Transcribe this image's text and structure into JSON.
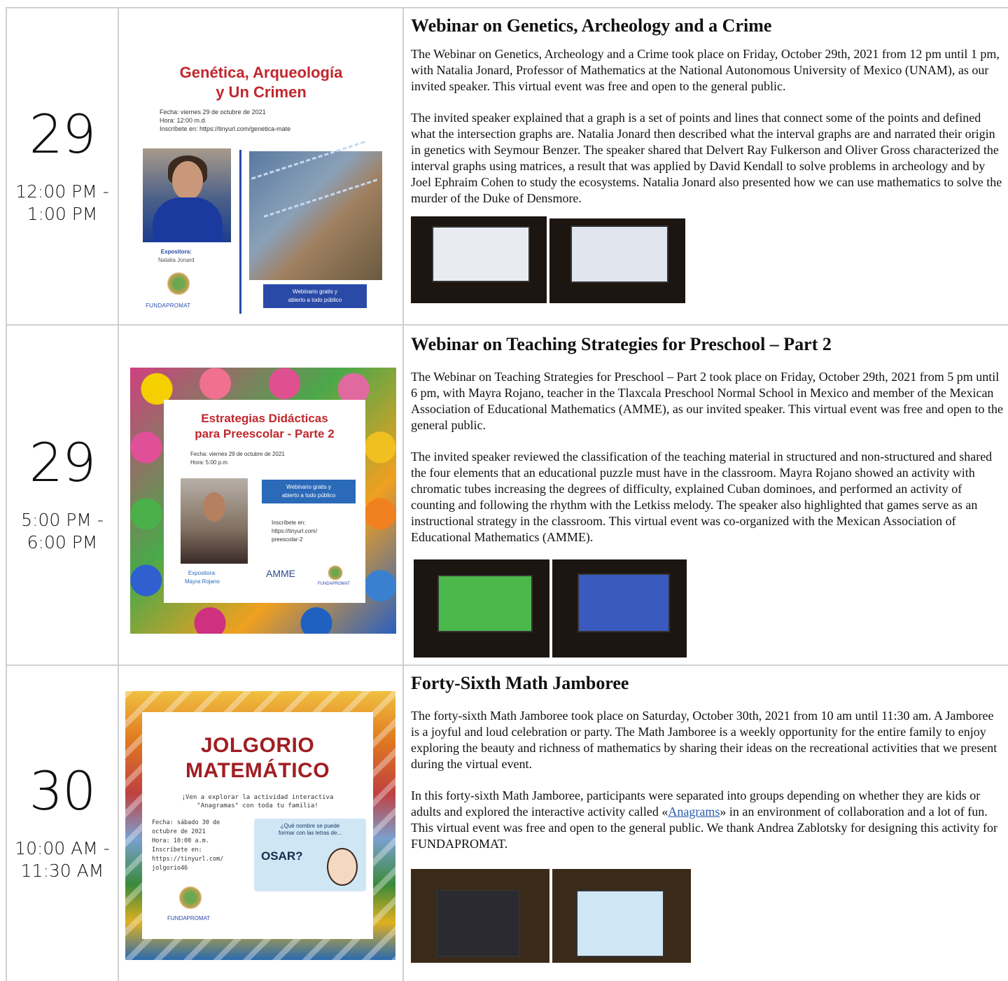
{
  "events": [
    {
      "day": "29",
      "time_line1": "12:00 PM -",
      "time_line2": "1:00 PM",
      "title": "Webinar on Genetics, Archeology and a Crime",
      "paragraphs": [
        "The Webinar on Genetics, Archeology and a Crime took place on Friday, October 29th, 2021 from 12 pm until 1 pm, with Natalia Jonard, Professor of Mathematics at the National Autonomous University of Mexico (UNAM), as our invited speaker. This virtual event was free and open to the general public.",
        "The invited speaker explained that a graph is a set of points and lines that connect some of the points and defined what the intersection graphs are. Natalia Jonard then described what the interval graphs are and narrated their origin in genetics with Seymour Benzer. The speaker shared that Delvert Ray Fulkerson and Oliver Gross characterized the interval graphs using matrices, a result that was applied by David Kendall to solve problems in archeology and by Joel Ephraim Cohen to study the ecosystems. Natalia Jonard also presented how we can use mathematics to solve the murder of the Duke of Densmore."
      ],
      "poster": {
        "title_line1": "Genética, Arqueología",
        "title_line2": "y Un Crimen",
        "fecha": "Fecha: viernes 29 de octubre de 2021",
        "hora": "Hora: 12:00 m.d.",
        "inscribete": "Inscríbete en: https://tinyurl.com/genetica-mate",
        "expositora_label": "Expositora:",
        "expositora_name": "Natalia Jonard",
        "logo": "FUNDAPROMAT",
        "button_line1": "Webinario gratis y",
        "button_line2": "abierto a todo público"
      }
    },
    {
      "day": "29",
      "time_line1": "5:00 PM -",
      "time_line2": "6:00 PM",
      "title": "Webinar on Teaching Strategies for Preschool – Part 2",
      "paragraphs": [
        "The Webinar on Teaching Strategies for Preschool – Part 2 took place on Friday, October 29th, 2021 from 5 pm until 6 pm, with Mayra Rojano, teacher in the Tlaxcala Preschool Normal School in Mexico and member of the Mexican Association of Educational Mathematics (AMME), as our invited speaker. This virtual event was free and open to the general public.",
        "The invited speaker reviewed the classification of the teaching material in structured and non-structured and shared the four elements that an educational puzzle must have in the classroom. Mayra Rojano showed an activity with chromatic tubes increasing the degrees of difficulty, explained Cuban dominoes, and performed an activity of counting and following the rhythm with the Letkiss melody. The speaker also highlighted that games serve as an instructional strategy in the classroom. This virtual event was co-organized with the Mexican Association of Educational Mathematics (AMME)."
      ],
      "poster": {
        "title_line1": "Estrategias Didácticas",
        "title_line2": "para Preescolar - Parte 2",
        "fecha": "Fecha: viernes 29 de octubre de 2021",
        "hora": "Hora: 5:00 p.m.",
        "button_line1": "Webinario gratis y",
        "button_line2": "abierto a todo público",
        "inscribete_label": "Inscríbete en:",
        "inscribete_url1": "https://tinyurl.com/",
        "inscribete_url2": "preescolar-2",
        "expositora_label": "Expositora:",
        "expositora_name": "Mayra Rojano",
        "amme": "AMME",
        "logo": "FUNDAPROMAT"
      }
    },
    {
      "day": "30",
      "time_line1": "10:00 AM -",
      "time_line2": "11:30 AM",
      "title": "Forty-Sixth Math Jamboree",
      "paragraphs": [
        "The forty-sixth Math Jamboree took place on Saturday, October 30th, 2021 from 10 am until 11:30 am. A Jamboree is a joyful and loud celebration or party. The Math Jamboree is a weekly opportunity for the entire family to enjoy exploring the beauty and richness of mathematics by sharing their ideas on the recreational activities that we present during the virtual event."
      ],
      "para2_before": "In this forty-sixth Math Jamboree, participants were separated into groups depending on whether they are kids or adults and explored the interactive activity called «",
      "para2_link": "Anagrams",
      "para2_after": "» in an environment of collaboration and a lot of fun. This virtual event was free and open to the general public. We thank Andrea Zablotsky for designing this activity for FUNDAPROMAT.",
      "poster": {
        "title_line1": "JOLGORIO",
        "title_line2": "MATEMÁTICO",
        "sub_line1": "¡Ven a explorar la actividad interactiva",
        "sub_line2": "\"Anagramas\" con toda tu familia!",
        "fecha": "Fecha: sábado 30 de",
        "fecha2": "octubre de 2021",
        "hora": "Hora: 10:00 a.m.",
        "inscribete": "Inscríbete en:",
        "url1": "https://tinyurl.com/",
        "url2": "jolgorio46",
        "question_line1": "¿Qué nombre se puede",
        "question_line2": "formar con las letras de...",
        "osar": "OSAR?",
        "logo": "FUNDAPROMAT"
      }
    }
  ]
}
